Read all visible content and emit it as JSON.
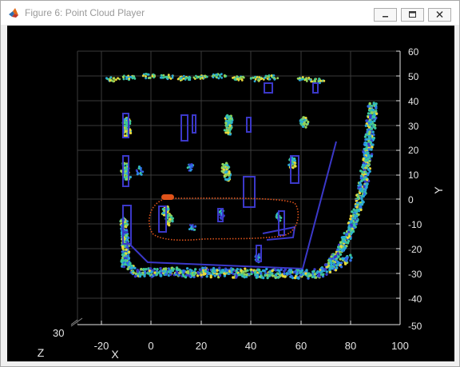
{
  "window": {
    "title": "Figure 6: Point Cloud Player",
    "icons": {
      "app": "matlab-logo-icon",
      "minimize": "minimize-icon",
      "maximize": "maximize-icon",
      "close": "close-icon"
    }
  },
  "plot": {
    "background": "#000000",
    "axis_color": "#e6e6e6",
    "grid_color": "#3a3a3a",
    "colormap": [
      "#3b38c8",
      "#2f6ee8",
      "#29a8d8",
      "#3cc79a",
      "#8fd35a",
      "#e9d83a"
    ],
    "trajectory_color": "#e0531a",
    "x_axis": {
      "label": "X",
      "ticks": [
        "-20",
        "0",
        "20",
        "40",
        "60",
        "80",
        "100"
      ]
    },
    "y_axis": {
      "label": "Y",
      "ticks": [
        "60",
        "50",
        "40",
        "30",
        "20",
        "10",
        "0",
        "-10",
        "-20",
        "-30",
        "-40",
        "-50"
      ]
    },
    "z_axis": {
      "label": "Z",
      "tick": "30"
    }
  }
}
